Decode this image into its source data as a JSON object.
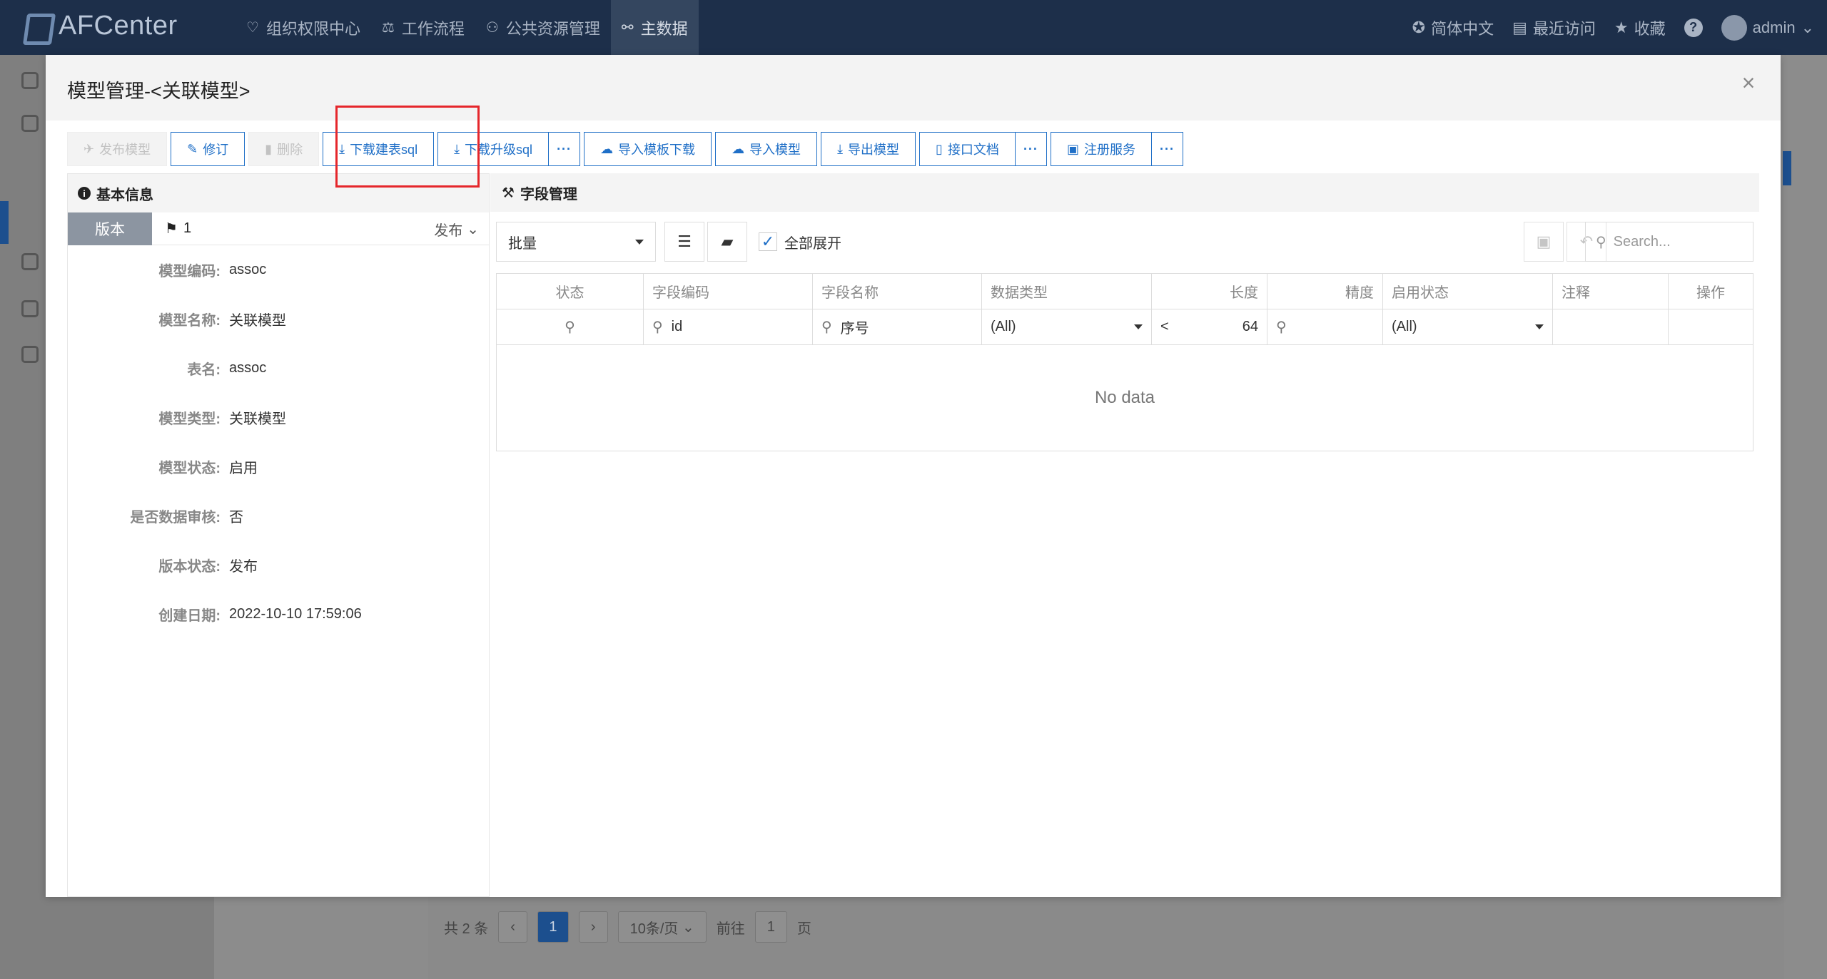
{
  "app": {
    "logo_text": "AFCenter"
  },
  "nav": {
    "items": [
      {
        "label": "组织权限中心",
        "icon": "shield-icon"
      },
      {
        "label": "工作流程",
        "icon": "scale-icon"
      },
      {
        "label": "公共资源管理",
        "icon": "users-icon"
      },
      {
        "label": "主数据",
        "icon": "master-data-icon"
      }
    ],
    "active_index": 3
  },
  "topright": {
    "language": "简体中文",
    "recent": "最近访问",
    "favorite": "收藏",
    "help": "?",
    "user": "admin"
  },
  "modal": {
    "title": "模型管理-<关联模型>",
    "close": "×"
  },
  "toolbar": {
    "publish": "发布模型",
    "revise": "修订",
    "delete": "删除",
    "download_create_sql": "下载建表sql",
    "download_upgrade_sql": "下载升级sql",
    "import_template": "导入模板下载",
    "import_model": "导入模型",
    "export_model": "导出模型",
    "api_doc": "接口文档",
    "register_service": "注册服务",
    "more": "···"
  },
  "basic_info": {
    "title": "基本信息",
    "version_tab": "版本",
    "version_number": "1",
    "version_status": "发布",
    "rows": [
      {
        "label": "模型编码:",
        "value": "assoc"
      },
      {
        "label": "模型名称:",
        "value": "关联模型"
      },
      {
        "label": "表名:",
        "value": "assoc"
      },
      {
        "label": "模型类型:",
        "value": "关联模型"
      },
      {
        "label": "模型状态:",
        "value": "启用"
      },
      {
        "label": "是否数据审核:",
        "value": "否"
      },
      {
        "label": "版本状态:",
        "value": "发布"
      },
      {
        "label": "创建日期:",
        "value": "2022-10-10 17:59:06"
      }
    ]
  },
  "fields": {
    "title": "字段管理",
    "batch": "批量",
    "expand_all": "全部展开",
    "expand_checked": true,
    "search_placeholder": "Search...",
    "columns": [
      "状态",
      "字段编码",
      "字段名称",
      "数据类型",
      "长度",
      "精度",
      "启用状态",
      "注释",
      "操作"
    ],
    "filters": {
      "code": "id",
      "name": "序号",
      "data_type": "(All)",
      "length_op": "<",
      "length": "64",
      "enabled": "(All)"
    },
    "empty_text": "No data"
  },
  "pager": {
    "total": "共 2 条",
    "current": "1",
    "page_size": "10条/页",
    "goto_label": "前往",
    "goto_value": "1",
    "page_suffix": "页"
  }
}
